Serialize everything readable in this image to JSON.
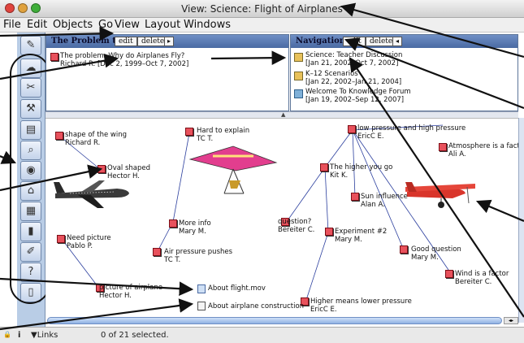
{
  "window": {
    "title": "View: Science: Flight of Airplanes",
    "controls": {
      "close_color": "#e0443e",
      "minimize_color": "#e0a23e",
      "zoom_color": "#3fae3a"
    }
  },
  "menu": [
    "File",
    "Edit",
    "Objects",
    "Go",
    "View",
    "Layout",
    "Windows"
  ],
  "tool_icons": [
    "pencil-icon",
    "cloud-icon",
    "scissors-icon",
    "tools-icon",
    "notes-icon",
    "magnifier-icon",
    "eye-icon",
    "building-icon",
    "graph-icon",
    "bar-chart-icon",
    "brush-icon",
    "help-icon",
    "trash-icon"
  ],
  "problem_panel": {
    "title": "The Problem to Solve",
    "edit_label": "edit",
    "delete_label": "delete",
    "arrow": "▸",
    "entry": {
      "line1": "The problem: Why do Airplanes Fly?",
      "line2": "Richard R.  [Dec 2, 1999–Oct 7, 2002]"
    }
  },
  "nav_panel": {
    "title": "Navigation Bar",
    "edit_label": "edit",
    "delete_label": "delete",
    "arrow": "◂",
    "items": [
      {
        "line1": "Science: Teacher Discussion",
        "line2": "[Jan 21, 2002–Oct 7, 2002]"
      },
      {
        "line1": "K–12 Scenarios",
        "line2": "[Jan 22, 2002–Jan 21, 2004]"
      },
      {
        "line1": "Welcome To Knowledge Forum",
        "line2": "[Jan 19, 2002–Sep 12, 2007]"
      }
    ]
  },
  "notes": [
    {
      "line1": "shape of the wing",
      "line2": "Richard R."
    },
    {
      "line1": "Oval shaped",
      "line2": "Hector H."
    },
    {
      "line1": "Need picture",
      "line2": "Pablo P."
    },
    {
      "line1": "picture of airplane",
      "line2": "Hector H."
    },
    {
      "line1": "Hard to explain",
      "line2": "TC T."
    },
    {
      "line1": "More info",
      "line2": "Mary M."
    },
    {
      "line1": "Air pressure pushes",
      "line2": "TC T."
    },
    {
      "line1": "low pressure and high pressure",
      "line2": "EricC E."
    },
    {
      "line1": "Atmosphere is a factor",
      "line2": "Ali A."
    },
    {
      "line1": "The higher you go",
      "line2": "Kit K."
    },
    {
      "line1": "Sun influence",
      "line2": "Alan A."
    },
    {
      "line1": "question?",
      "line2": "Bereiter C."
    },
    {
      "line1": "Experiment #2",
      "line2": "Mary M."
    },
    {
      "line1": "Good question",
      "line2": "Mary M."
    },
    {
      "line1": "Wind is a factor",
      "line2": "Bereiter C."
    },
    {
      "line1": "Higher means lower pressure",
      "line2": "EricC E."
    }
  ],
  "attachments": [
    {
      "label": "About flight.mov",
      "icon": "movie-file-icon"
    },
    {
      "label": "About airplane construction",
      "icon": "document-icon"
    }
  ],
  "status": {
    "lock_label": "🔒",
    "info_label": "i",
    "links_label": "▼Links",
    "selection": "0 of 21 selected."
  },
  "colors": {
    "panel_header": "#5677b0",
    "note_red": "#e8515c",
    "toolbar_bg": "#b9cde6"
  }
}
